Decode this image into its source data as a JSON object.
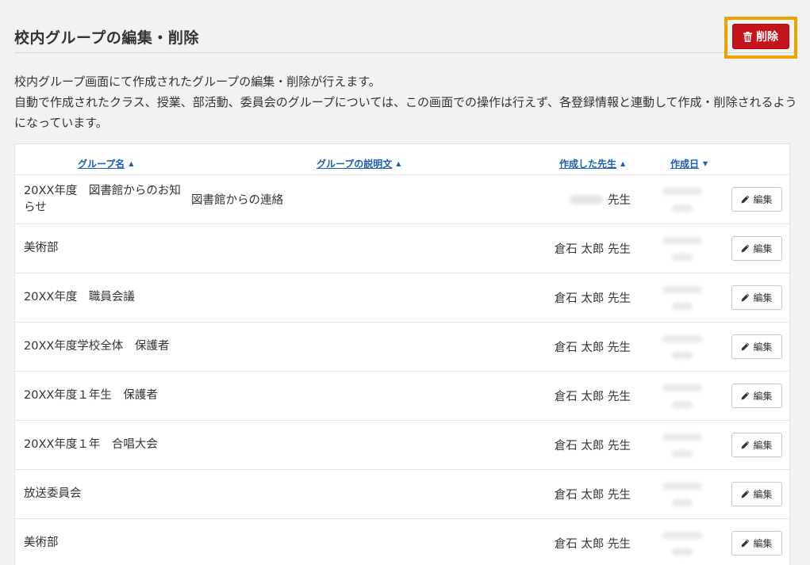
{
  "header": {
    "title": "校内グループの編集・削除",
    "delete_label": "削除"
  },
  "description": {
    "line1": "校内グループ画面にて作成されたグループの編集・削除が行えます。",
    "line2": "自動で作成されたクラス、授業、部活動、委員会のグループについては、この画面での操作は行えず、各登録情報と連動して作成・削除されるようになっています。"
  },
  "table": {
    "columns": {
      "name": "グループ名",
      "description": "グループの説明文",
      "teacher": "作成した先生",
      "date": "作成日"
    },
    "sort_indicators": {
      "name": "asc",
      "description": "asc",
      "teacher": "asc",
      "date": "desc"
    },
    "edit_label": "編集",
    "rows": [
      {
        "name": "20XX年度　図書館からのお知らせ",
        "description": "図書館からの連絡",
        "teacher": "先生",
        "teacher_blurred": true
      },
      {
        "name": "美術部",
        "description": "",
        "teacher": "倉石 太郎 先生",
        "teacher_blurred": false
      },
      {
        "name": "20XX年度　職員会議",
        "description": "",
        "teacher": "倉石 太郎 先生",
        "teacher_blurred": false
      },
      {
        "name": "20XX年度学校全体　保護者",
        "description": "",
        "teacher": "倉石 太郎 先生",
        "teacher_blurred": false
      },
      {
        "name": "20XX年度１年生　保護者",
        "description": "",
        "teacher": "倉石 太郎 先生",
        "teacher_blurred": false
      },
      {
        "name": "20XX年度１年　合唱大会",
        "description": "",
        "teacher": "倉石 太郎 先生",
        "teacher_blurred": false
      },
      {
        "name": "放送委員会",
        "description": "",
        "teacher": "倉石 太郎 先生",
        "teacher_blurred": false
      },
      {
        "name": "美術部",
        "description": "",
        "teacher": "倉石 太郎 先生",
        "teacher_blurred": false
      }
    ]
  },
  "colors": {
    "delete_button": "#c4141c",
    "highlight": "#f0a000",
    "link": "#1a5fb4"
  },
  "icons": {
    "delete": "trash-icon",
    "edit": "pencil-icon",
    "sort_asc": "caret-up-icon",
    "sort_desc": "caret-down-icon"
  }
}
